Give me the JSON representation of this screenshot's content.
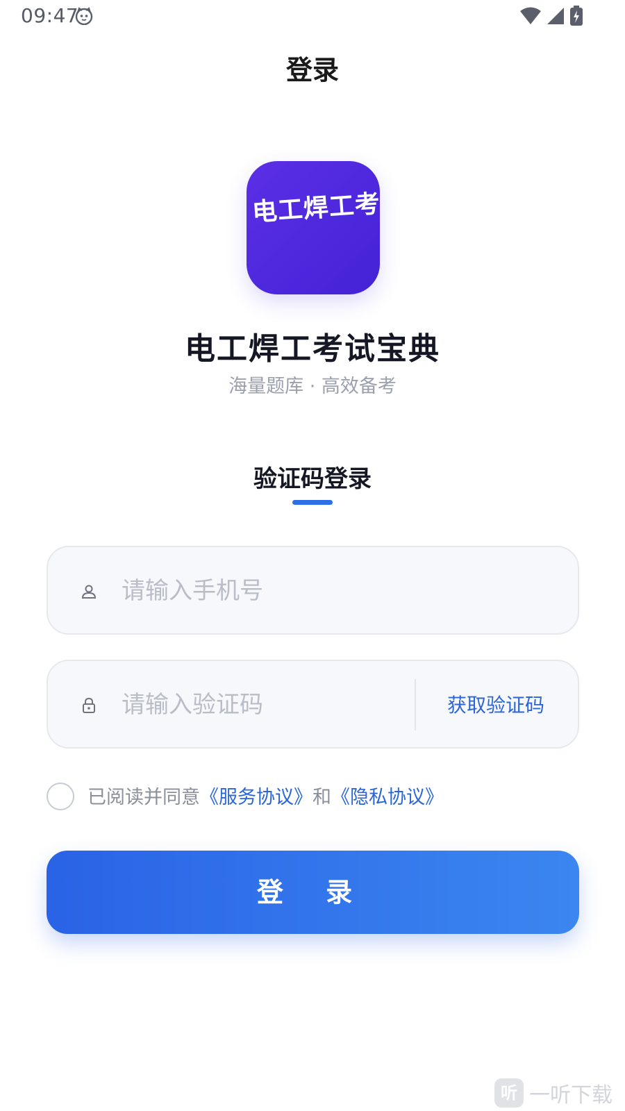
{
  "status_bar": {
    "time": "09:47",
    "icons": [
      "cat-face-icon",
      "wifi-icon",
      "cell-signal-icon",
      "battery-charging-icon"
    ]
  },
  "nav": {
    "title": "登录"
  },
  "app": {
    "logo_text": "电工焊工考试宝典",
    "name": "电工焊工考试宝典",
    "slogan": "海量题库 · 高效备考",
    "logo_colors": [
      "#5b2fe6",
      "#4422d6"
    ]
  },
  "login_tab": {
    "label": "验证码登录",
    "accent": "#2f6fe6"
  },
  "form": {
    "phone": {
      "placeholder": "请输入手机号",
      "value": "",
      "icon": "user-icon"
    },
    "code": {
      "placeholder": "请输入验证码",
      "value": "",
      "icon": "lock-icon",
      "get_code_label": "获取验证码"
    }
  },
  "agreement": {
    "checked": false,
    "prefix": "已阅读并同意",
    "service_link": "《服务协议》",
    "conjunction": "和",
    "privacy_link": "《隐私协议》"
  },
  "login_button": {
    "label": "登 录",
    "colors": [
      "#2a63e6",
      "#3b86f0"
    ]
  },
  "watermark": {
    "badge": "听",
    "text": "一听下载"
  }
}
